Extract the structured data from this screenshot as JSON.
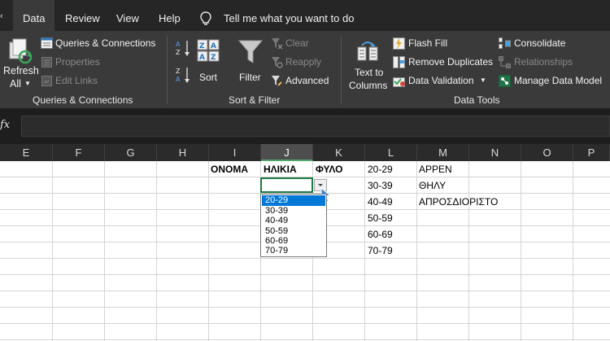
{
  "tabs": {
    "data": "Data",
    "review": "Review",
    "view": "View",
    "help": "Help",
    "tell_me": "Tell me what you want to do"
  },
  "ribbon": {
    "refresh_label": "Refresh",
    "refresh_sub": "All",
    "queries_connections": "Queries & Connections",
    "properties": "Properties",
    "edit_links": "Edit Links",
    "group_queries": "Queries & Connections",
    "sort": "Sort",
    "filter": "Filter",
    "clear": "Clear",
    "reapply": "Reapply",
    "advanced": "Advanced",
    "group_sort": "Sort & Filter",
    "text_to": "Text to",
    "columns": "Columns",
    "flash_fill": "Flash Fill",
    "remove_duplicates": "Remove Duplicates",
    "data_validation": "Data Validation",
    "consolidate": "Consolidate",
    "relationships": "Relationships",
    "manage_data_model": "Manage Data Model",
    "group_data_tools": "Data Tools"
  },
  "formula_bar": {
    "fx": "fx"
  },
  "columns": [
    "E",
    "F",
    "G",
    "H",
    "I",
    "J",
    "K",
    "L",
    "M",
    "N",
    "O",
    "P"
  ],
  "selected_column": "J",
  "cells": {
    "i1": "ΟΝΟΜΑ",
    "j1": "ΗΛΙΚΙΑ",
    "k1": "ΦΥΛΟ",
    "l": [
      "20-29",
      "30-39",
      "40-49",
      "50-59",
      "60-69",
      "70-79"
    ],
    "m": [
      "ΑΡΡΕΝ",
      "ΘΗΛΥ",
      "ΑΠΡΟΣΔΙΟΡΙΣΤΟ"
    ]
  },
  "dropdown": {
    "options": [
      "20-29",
      "30-39",
      "40-49",
      "50-59",
      "60-69",
      "70-79"
    ],
    "highlighted": "20-29"
  },
  "colors": {
    "accent_green": "#217346",
    "highlight_blue": "#0078d7"
  }
}
